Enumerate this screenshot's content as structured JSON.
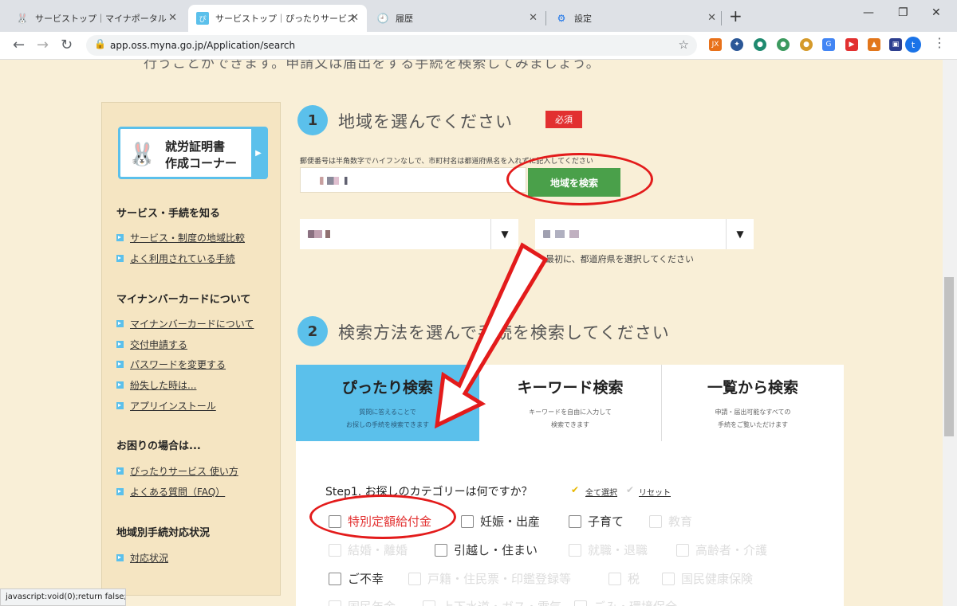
{
  "browser": {
    "tabs": [
      {
        "label": "サービストップ｜マイナポータル",
        "icon": "bunny-favicon"
      },
      {
        "label": "サービストップ｜ぴったりサービス",
        "icon": "pittari-favicon"
      },
      {
        "label": "履歴",
        "icon": "history-icon"
      },
      {
        "label": "設定",
        "icon": "gear-icon"
      }
    ],
    "url": "app.oss.myna.go.jp/Application/search",
    "profile_initial": "t",
    "status_bar": "javascript:void(0);return false;"
  },
  "page": {
    "top_cut_text": "行うことができます。申請又は届出をする手続を検索してみましょう。"
  },
  "sidebar": {
    "certificate_banner": "就労証明書\n作成コーナー",
    "sections": [
      {
        "title": "サービス・手続を知る",
        "links": [
          "サービス・制度の地域比較",
          "よく利用されている手続"
        ]
      },
      {
        "title": "マイナンバーカードについて",
        "links": [
          "マイナンバーカードについて",
          "交付申請する",
          "パスワードを変更する",
          "紛失した時は...",
          "アプリインストール"
        ]
      },
      {
        "title": "お困りの場合は...",
        "links": [
          "ぴったりサービス 使い方",
          "よくある質問（FAQ）"
        ]
      },
      {
        "title": "地域別手続対応状況",
        "links": [
          "対応状況"
        ]
      }
    ]
  },
  "step1": {
    "number": "1",
    "heading": "地域を選んでください",
    "required_badge": "必須",
    "hint": "郵便番号は半角数字でハイフンなしで、市町村名は都道府県名を入れずに記入してください",
    "search_button": "地域を検索",
    "select_hint": "最初に、都道府県を選択してください"
  },
  "step2": {
    "number": "2",
    "heading": "検索方法を選んで手続を検索してください",
    "tabs": [
      {
        "title": "ぴったり検索",
        "desc": "質問に答えることで\nお探しの手続を検索できます"
      },
      {
        "title": "キーワード検索",
        "desc": "キーワードを自由に入力して\n検索できます"
      },
      {
        "title": "一覧から検索",
        "desc": "申請・届出可能なすべての\n手続をご覧いただけます"
      }
    ],
    "category_question": "Step1. お探しのカテゴリーは何ですか？",
    "select_all": "全て選択",
    "reset": "リセット",
    "categories": {
      "row1": [
        "特別定額給付金",
        "妊娠・出産",
        "子育て",
        "教育"
      ],
      "row2": [
        "結婚・離婚",
        "引越し・住まい",
        "就職・退職",
        "高齢者・介護"
      ],
      "row3": [
        "ご不幸",
        "戸籍・住民票・印鑑登録等",
        "税",
        "国民健康保険"
      ],
      "row4": [
        "国民年金",
        "上下水道・ガス・電気",
        "ごみ・環境保全"
      ]
    }
  },
  "colors": {
    "accent": "#5bc0eb",
    "page_bg": "#f9efd7",
    "sidebar_bg": "#f5e5c2",
    "required": "#e23030",
    "button": "#4aa04a",
    "annotation": "#e31b1b"
  }
}
